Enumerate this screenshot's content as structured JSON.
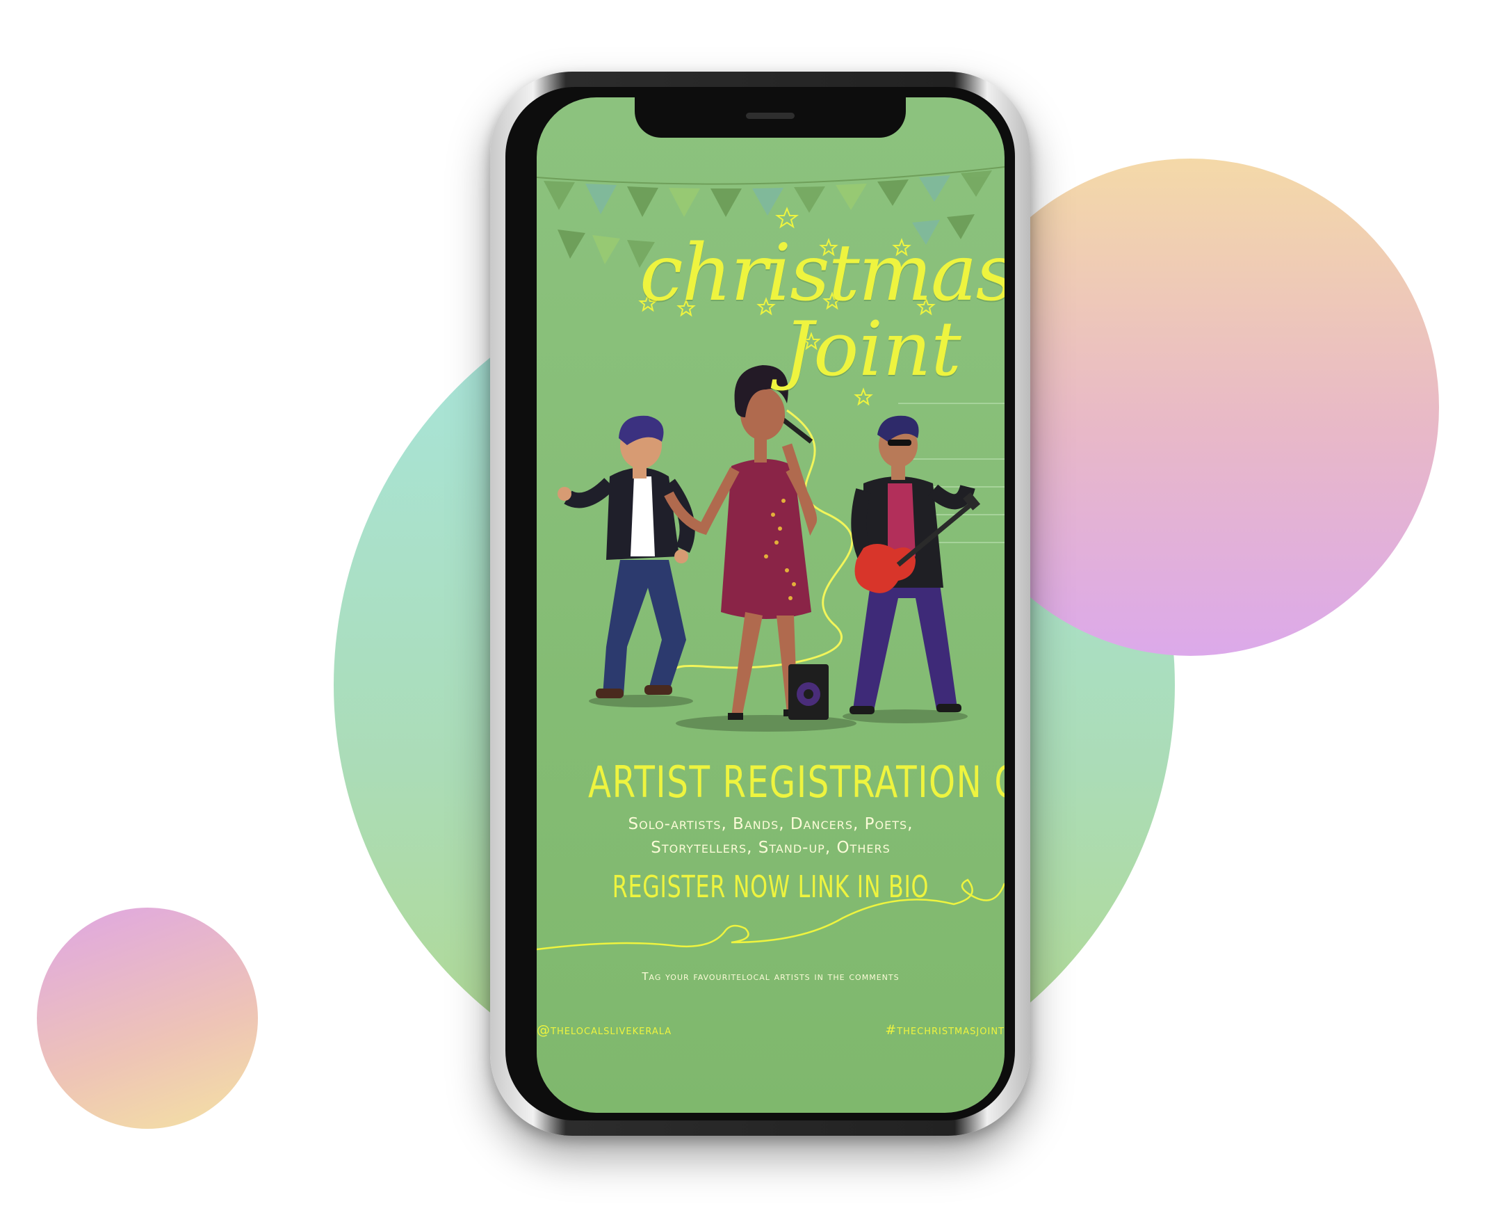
{
  "poster": {
    "title_line1": "christmas",
    "title_line2": "Joint",
    "headline": "ARTIST REGISTRATION OPEN",
    "subtitle_line1": "Solo-artists, Bands, Dancers, Poets,",
    "subtitle_line2": "Storytellers, Stand-up, Others",
    "call_to_action": "REGISTER NOW LINK IN BIO",
    "tagline": "Tag your favouritelocal artists in the comments",
    "handle_left": "@thelocalslivekerala",
    "handle_right": "#thechristmasjoint"
  },
  "colors": {
    "screen_bg": "#86bd76",
    "accent_yellow": "#eef43f",
    "circle_big": "#a8e6c6",
    "circle_right": "#e8b8c8",
    "circle_small": "#dfa6e3"
  },
  "illustration": {
    "figures": [
      "dancer",
      "singer",
      "guitarist"
    ],
    "props": [
      "microphone",
      "speaker",
      "guitar",
      "bunting-flags",
      "stars"
    ]
  }
}
